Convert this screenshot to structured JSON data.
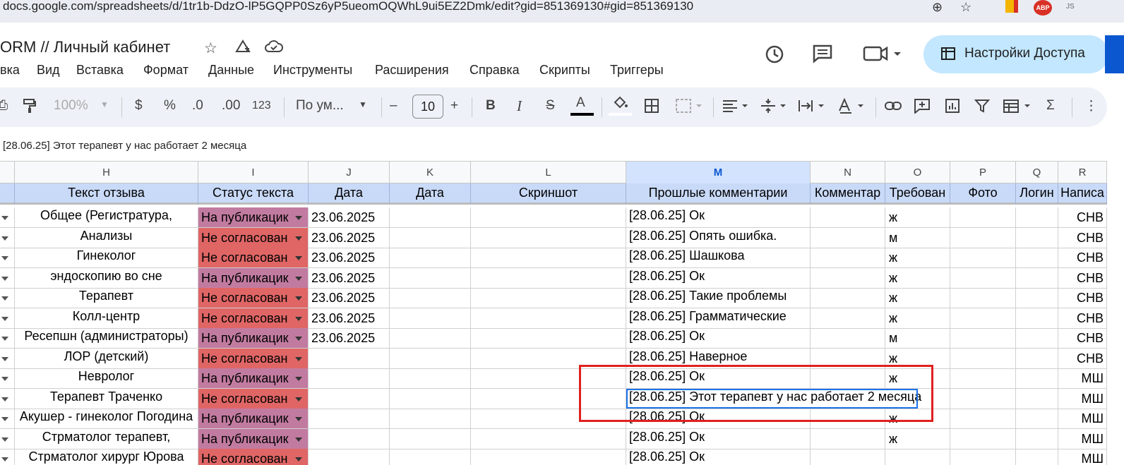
{
  "browser": {
    "url": "docs.google.com/spreadsheets/d/1tr1b-DdzO-lP5GQPP0Sz6yP5ueomOQWhL9ui5EZ2Dmk/edit?gid=851369130#gid=851369130",
    "zoom_icon": "⊕",
    "bookmark_icon": "☆",
    "ext_abp": "ABP",
    "ext_js": "JS"
  },
  "doc": {
    "title": "ORM // Личный кабинет"
  },
  "menu": [
    "вка",
    "Вид",
    "Вставка",
    "Формат",
    "Данные",
    "Инструменты",
    "Расширения",
    "Справка",
    "Скрипты",
    "Триггеры"
  ],
  "share": {
    "label": "Настройки Доступа"
  },
  "toolbar": {
    "zoom": "100%",
    "currency": "$",
    "percent": "%",
    "dec_decrease": ".0",
    "dec_increase": ".00",
    "number_format": "123",
    "font": "По ум...",
    "font_size": "10",
    "bold": "B",
    "italic": "I",
    "strike": "S",
    "text_color": "A",
    "minus": "–",
    "plus": "+"
  },
  "formula_bar": {
    "text": "[28.06.25] Этот терапевт у нас работает 2 месяца"
  },
  "columns": {
    "letters": [
      "",
      "H",
      "I",
      "J",
      "K",
      "L",
      "M",
      "N",
      "O",
      "P",
      "Q",
      "R"
    ],
    "active": "M",
    "headers": [
      "",
      "Текст отзыва",
      "Статус текста",
      "Дата",
      "Дата",
      "Скриншот",
      "Прошлые комментарии",
      "Комментар",
      "Требован",
      "Фото",
      "Логин",
      "Написа"
    ]
  },
  "status_colors": {
    "pub": "#c27ba0",
    "not": "#e06666",
    "selection": "#1a73e8",
    "highlight": "#e02020"
  },
  "rows": [
    {
      "h": "Общее (Регистратура,",
      "status": "На публикацик",
      "st": "pub",
      "date": "23.06.2025",
      "m": "[28.06.25] Ок",
      "o": "ж",
      "r": "СНВ"
    },
    {
      "h": "Анализы",
      "status": "Не согласован",
      "st": "not",
      "date": "23.06.2025",
      "m": "[28.06.25] Опять ошибка.",
      "o": "м",
      "r": "СНВ"
    },
    {
      "h": "Гинеколог",
      "status": "Не согласован",
      "st": "not",
      "date": "23.06.2025",
      "m": "[28.06.25] Шашкова",
      "o": "ж",
      "r": "СНВ"
    },
    {
      "h": "эндоскопию во сне",
      "status": "На публикацик",
      "st": "pub",
      "date": "23.06.2025",
      "m": "[28.06.25] Ок",
      "o": "ж",
      "r": "СНВ"
    },
    {
      "h": "Терапевт",
      "status": "Не согласован",
      "st": "not",
      "date": "23.06.2025",
      "m": "[28.06.25] Такие проблемы",
      "o": "ж",
      "r": "СНВ"
    },
    {
      "h": "Колл-центр",
      "status": "Не согласован",
      "st": "not",
      "date": "23.06.2025",
      "m": "[28.06.25] Грамматические",
      "o": "ж",
      "r": "СНВ"
    },
    {
      "h": "Ресепшн (администраторы)",
      "status": "На публикацик",
      "st": "pub",
      "date": "23.06.2025",
      "m": "[28.06.25] Ок",
      "o": "м",
      "r": "СНВ"
    },
    {
      "h": "ЛОР (детский)",
      "status": "Не согласован",
      "st": "not",
      "date": "",
      "m": "[28.06.25] Наверное",
      "o": "ж",
      "r": "СНВ"
    },
    {
      "h": "Невролог",
      "status": "На публикацик",
      "st": "pub",
      "date": "",
      "m": "[28.06.25] Ок",
      "o": "ж",
      "r": "МШ"
    },
    {
      "h": "Терапевт Траченко",
      "status": "Не согласован",
      "st": "not",
      "date": "",
      "m": "[28.06.25] Этот терапевт у нас работает 2 месяца",
      "o": "",
      "r": "МШ",
      "selected": true
    },
    {
      "h": "Акушер - гинеколог Погодина",
      "status": "На публикацик",
      "st": "pub",
      "date": "",
      "m": "[28.06.25] Ок",
      "o": "ж",
      "r": "МШ"
    },
    {
      "h": "Стрматолог терапевт,",
      "status": "На публикацик",
      "st": "pub",
      "date": "",
      "m": "[28.06.25] Ок",
      "o": "ж",
      "r": "МШ"
    },
    {
      "h": "Стрматолог хирург Юрова",
      "status": "Не согласован",
      "st": "not",
      "date": "",
      "m": "[28.06.25] Ок",
      "o": "",
      "r": "МШ"
    }
  ]
}
